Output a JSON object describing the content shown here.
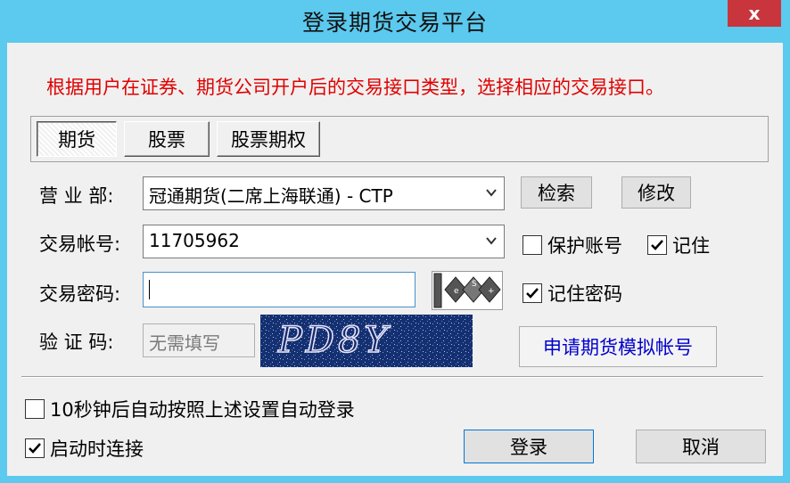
{
  "window": {
    "title": "登录期货交易平台",
    "close_label": "x"
  },
  "notice": "根据用户在证券、期货公司开户后的交易接口类型，选择相应的交易接口。",
  "tabs": [
    {
      "label": "期货",
      "active": true
    },
    {
      "label": "股票",
      "active": false
    },
    {
      "label": "股票期权",
      "active": false
    }
  ],
  "form": {
    "branch_label": "营 业 部:",
    "branch_value": "冠通期货(二席上海联通) - CTP",
    "search_button": "检索",
    "modify_button": "修改",
    "account_label": "交易帐号:",
    "account_value": "11705962",
    "protect_account": {
      "label": "保护账号",
      "checked": false
    },
    "remember": {
      "label": "记住",
      "checked": true
    },
    "password_label": "交易密码:",
    "password_value": "",
    "remember_password": {
      "label": "记住密码",
      "checked": true
    },
    "captcha_label": "验 证 码:",
    "captcha_placeholder": "无需填写",
    "captcha_text": "PD8Y",
    "apply_demo_button": "申请期货模拟帐号"
  },
  "footer": {
    "auto_login": {
      "label": "10秒钟后自动按照上述设置自动登录",
      "checked": false
    },
    "connect_on_start": {
      "label": "启动时连接",
      "checked": true
    },
    "login_button": "登录",
    "cancel_button": "取消"
  },
  "colors": {
    "titlebar": "#5cc9ee",
    "close": "#c8353c",
    "notice": "#e00000",
    "link": "#0000cc"
  }
}
